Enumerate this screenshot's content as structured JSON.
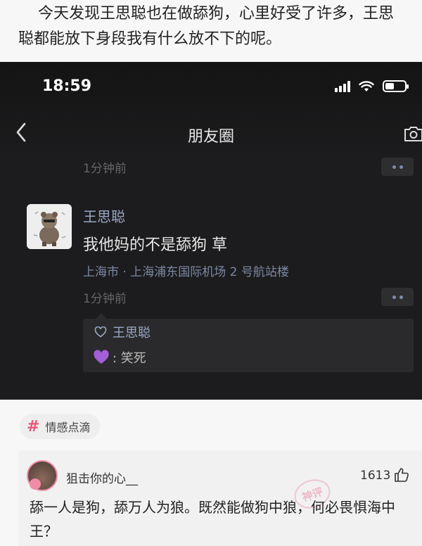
{
  "intro": {
    "text": "今天发现王思聪也在做舔狗，心里好受了许多，王思聪都能放下身段我有什么放不下的呢。"
  },
  "screenshot": {
    "status_bar": {
      "time": "18:59"
    },
    "nav": {
      "back_icon": "chevron-left-icon",
      "title": "朋友圈",
      "camera_icon": "camera-icon"
    },
    "prev_post_time": "1分钟前",
    "post": {
      "author": "王思聪",
      "text": "我他妈的不是舔狗 草",
      "location": "上海市 · 上海浦东国际机场 2 号航站楼",
      "time": "1分钟前",
      "likes": {
        "icon": "heart-outline-icon",
        "names": "王思聪"
      },
      "comment": {
        "emoji": "purple-heart-emoji",
        "text": ": 笑死"
      }
    }
  },
  "tag": {
    "icon": "hashtag-icon",
    "label": "情感点滴"
  },
  "comment_card": {
    "username": "狙击你的心__",
    "like_count": "1613",
    "thumb_icon": "thumbs-up-icon",
    "stamp_text": "神评",
    "text": "舔一人是狗，舔万人为狼。既然能做狗中狼，何必畏惧海中王？"
  },
  "colors": {
    "accent_pink": "#e45a7a",
    "name_blue": "#9aa6c3",
    "dark_bg": "#1c1c1e"
  }
}
